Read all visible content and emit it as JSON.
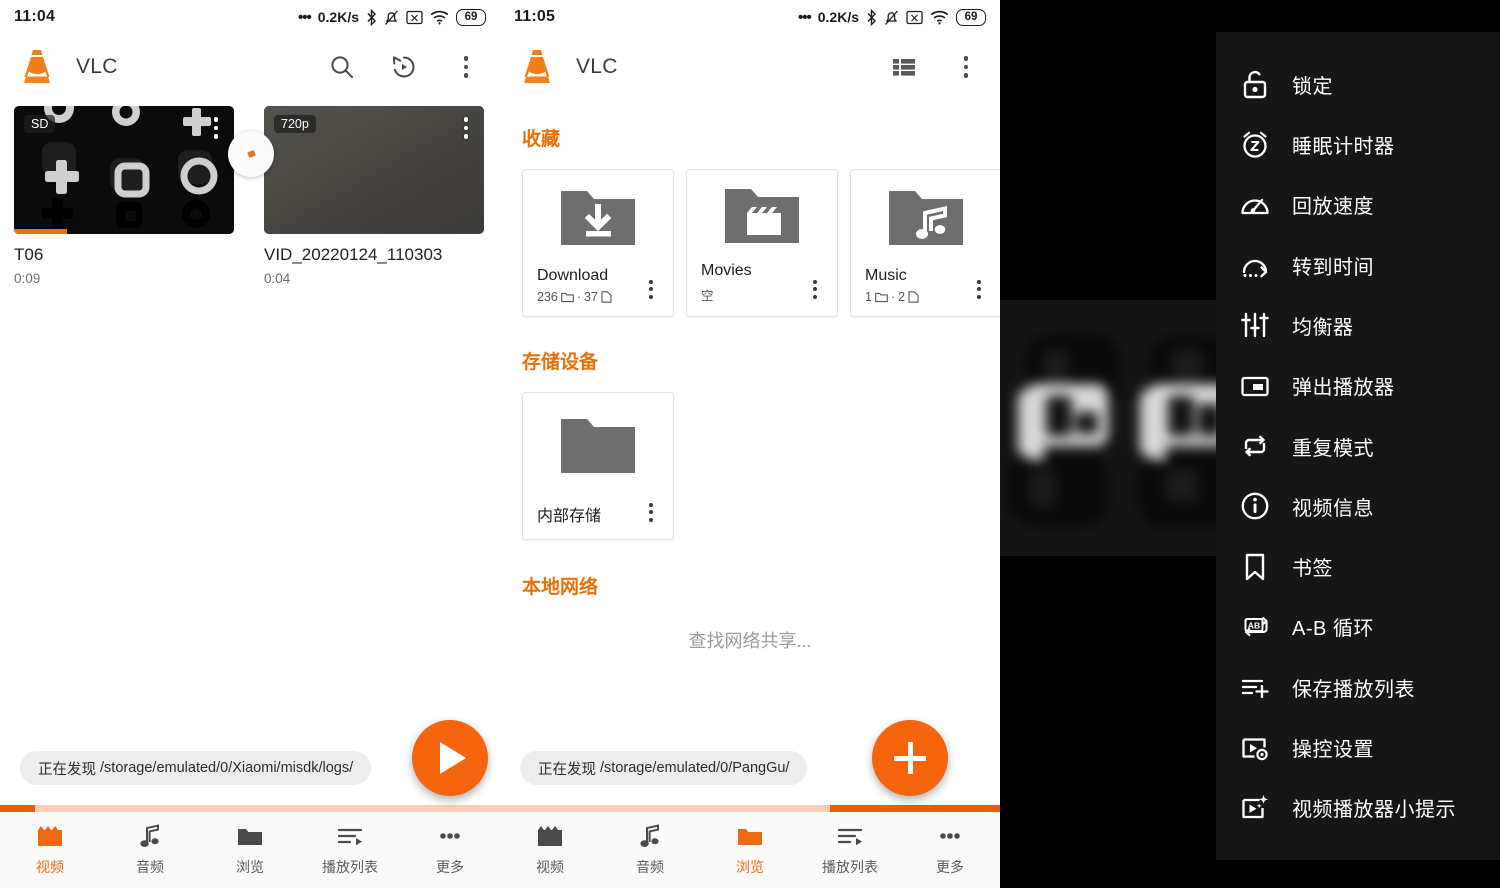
{
  "theme": {
    "accent": "#ee6a10",
    "accent_dark": "#ea5b0c",
    "sheet_bg": "#161616"
  },
  "panel1": {
    "statusbar": {
      "time": "11:04",
      "dots": "•••",
      "speed": "0.2K/s",
      "battery": "69"
    },
    "appbar": {
      "title": "VLC",
      "actions": [
        "search-icon",
        "history-icon",
        "overflow-icon"
      ]
    },
    "videos": [
      {
        "title": "T06",
        "duration": "0:09",
        "badge": "SD",
        "resume_percent": 24
      },
      {
        "title": "VID_20220124_110303",
        "duration": "0:04",
        "badge": "720p",
        "resume_percent": 0
      }
    ],
    "snackbar": {
      "prefix": "正在发现",
      "path": "/storage/emulated/0/Xiaomi/misdk/logs/"
    },
    "progress": {
      "start_percent": 0,
      "end_percent": 7
    },
    "bottomnav": {
      "active": 0,
      "items": [
        {
          "label": "视频",
          "icon": "clapperboard-icon"
        },
        {
          "label": "音频",
          "icon": "music-note-icon"
        },
        {
          "label": "浏览",
          "icon": "folder-icon"
        },
        {
          "label": "播放列表",
          "icon": "playlist-icon"
        },
        {
          "label": "更多",
          "icon": "more-icon"
        }
      ]
    },
    "fab": {
      "icon": "play-icon"
    }
  },
  "panel2": {
    "statusbar": {
      "time": "11:05",
      "dots": "•••",
      "speed": "0.2K/s",
      "battery": "69"
    },
    "appbar": {
      "title": "VLC",
      "actions": [
        "list-view-icon",
        "overflow-icon"
      ]
    },
    "sections": {
      "favorites": {
        "title": "收藏",
        "cards": [
          {
            "name": "Download",
            "meta_dirs": "236",
            "meta_files": "37",
            "icon": "folder-download-icon",
            "empty_label": ""
          },
          {
            "name": "Movies",
            "meta_dirs": "",
            "meta_files": "",
            "icon": "folder-movie-icon",
            "empty_label": "空"
          },
          {
            "name": "Music",
            "meta_dirs": "1",
            "meta_files": "2",
            "icon": "folder-music-icon",
            "empty_label": ""
          }
        ]
      },
      "storage": {
        "title": "存储设备",
        "cards": [
          {
            "name": "内部存储",
            "icon": "folder-icon"
          }
        ]
      },
      "network": {
        "title": "本地网络",
        "empty_text": "查找网络共享..."
      }
    },
    "snackbar": {
      "prefix": "正在发现",
      "path": "/storage/emulated/0/PangGu/"
    },
    "progress": {
      "start_percent": 66,
      "end_percent": 100
    },
    "bottomnav": {
      "active": 2,
      "items": [
        {
          "label": "视频",
          "icon": "clapperboard-icon"
        },
        {
          "label": "音频",
          "icon": "music-note-icon"
        },
        {
          "label": "浏览",
          "icon": "folder-icon"
        },
        {
          "label": "播放列表",
          "icon": "playlist-icon"
        },
        {
          "label": "更多",
          "icon": "more-icon"
        }
      ]
    },
    "fab": {
      "icon": "plus-icon"
    }
  },
  "panel3": {
    "menu": {
      "items": [
        {
          "label": "锁定",
          "icon": "lock-icon"
        },
        {
          "label": "睡眠计时器",
          "icon": "sleep-timer-icon"
        },
        {
          "label": "回放速度",
          "icon": "speed-icon"
        },
        {
          "label": "转到时间",
          "icon": "jump-to-time-icon"
        },
        {
          "label": "均衡器",
          "icon": "equalizer-icon"
        },
        {
          "label": "弹出播放器",
          "icon": "popup-player-icon"
        },
        {
          "label": "重复模式",
          "icon": "repeat-icon"
        },
        {
          "label": "视频信息",
          "icon": "info-icon"
        },
        {
          "label": "书签",
          "icon": "bookmark-icon"
        },
        {
          "label": "A-B 循环",
          "icon": "ab-repeat-icon"
        },
        {
          "label": "保存播放列表",
          "icon": "playlist-add-icon"
        },
        {
          "label": "操控设置",
          "icon": "player-settings-icon"
        },
        {
          "label": "视频播放器小提示",
          "icon": "player-tips-icon"
        }
      ]
    }
  }
}
